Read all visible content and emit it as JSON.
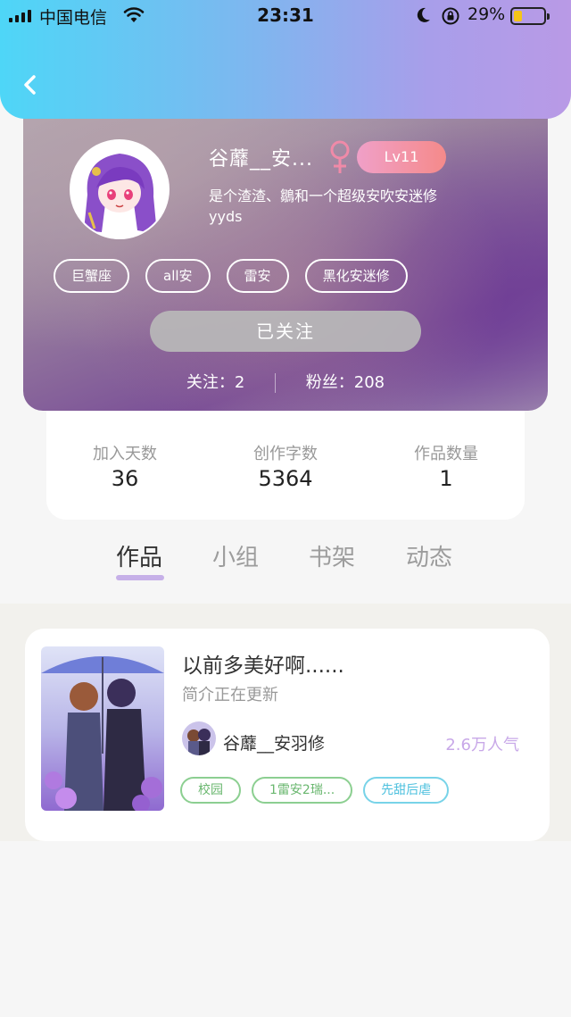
{
  "status_bar": {
    "carrier": "中国电信",
    "time": "23:31",
    "battery_percent": "29%",
    "battery_level": 0.29,
    "icons": [
      "signal-icon",
      "wifi-icon",
      "moon-icon",
      "rotation-lock-icon",
      "battery-icon"
    ]
  },
  "nav": {
    "back_icon": "chevron-left-icon"
  },
  "profile": {
    "username": "谷蘼__安...",
    "gender_icon": "female-icon",
    "level": "Lv11",
    "bio": "是个渣渣、鶵和一个超级安吹安迷修yyds",
    "tags": [
      "巨蟹座",
      "all安",
      "雷安",
      "黑化安迷修"
    ],
    "follow_button": "已关注",
    "following": "关注：2",
    "followers": "粉丝：208"
  },
  "stats": [
    {
      "label": "加入天数",
      "value": "36"
    },
    {
      "label": "创作字数",
      "value": "5364"
    },
    {
      "label": "作品数量",
      "value": "1"
    }
  ],
  "tabs": [
    "作品",
    "小组",
    "书架",
    "动态"
  ],
  "active_tab": "作品",
  "work": {
    "title": "以前多美好啊......",
    "intro": "简介正在更新",
    "author": "谷蘼__安羽修",
    "popularity": "2.6万人气",
    "tags": [
      "校园",
      "1雷安2瑞...",
      "先甜后虐"
    ]
  },
  "colors": {
    "header_gradient": [
      "#4ed6f7",
      "#b99ae6"
    ],
    "level_badge": "#f0a0c8",
    "tab_underline": "#c6b0e8",
    "popularity": "#c8a8e8",
    "tag_green": "#6ab76f",
    "tag_blue": "#4cc0de"
  }
}
